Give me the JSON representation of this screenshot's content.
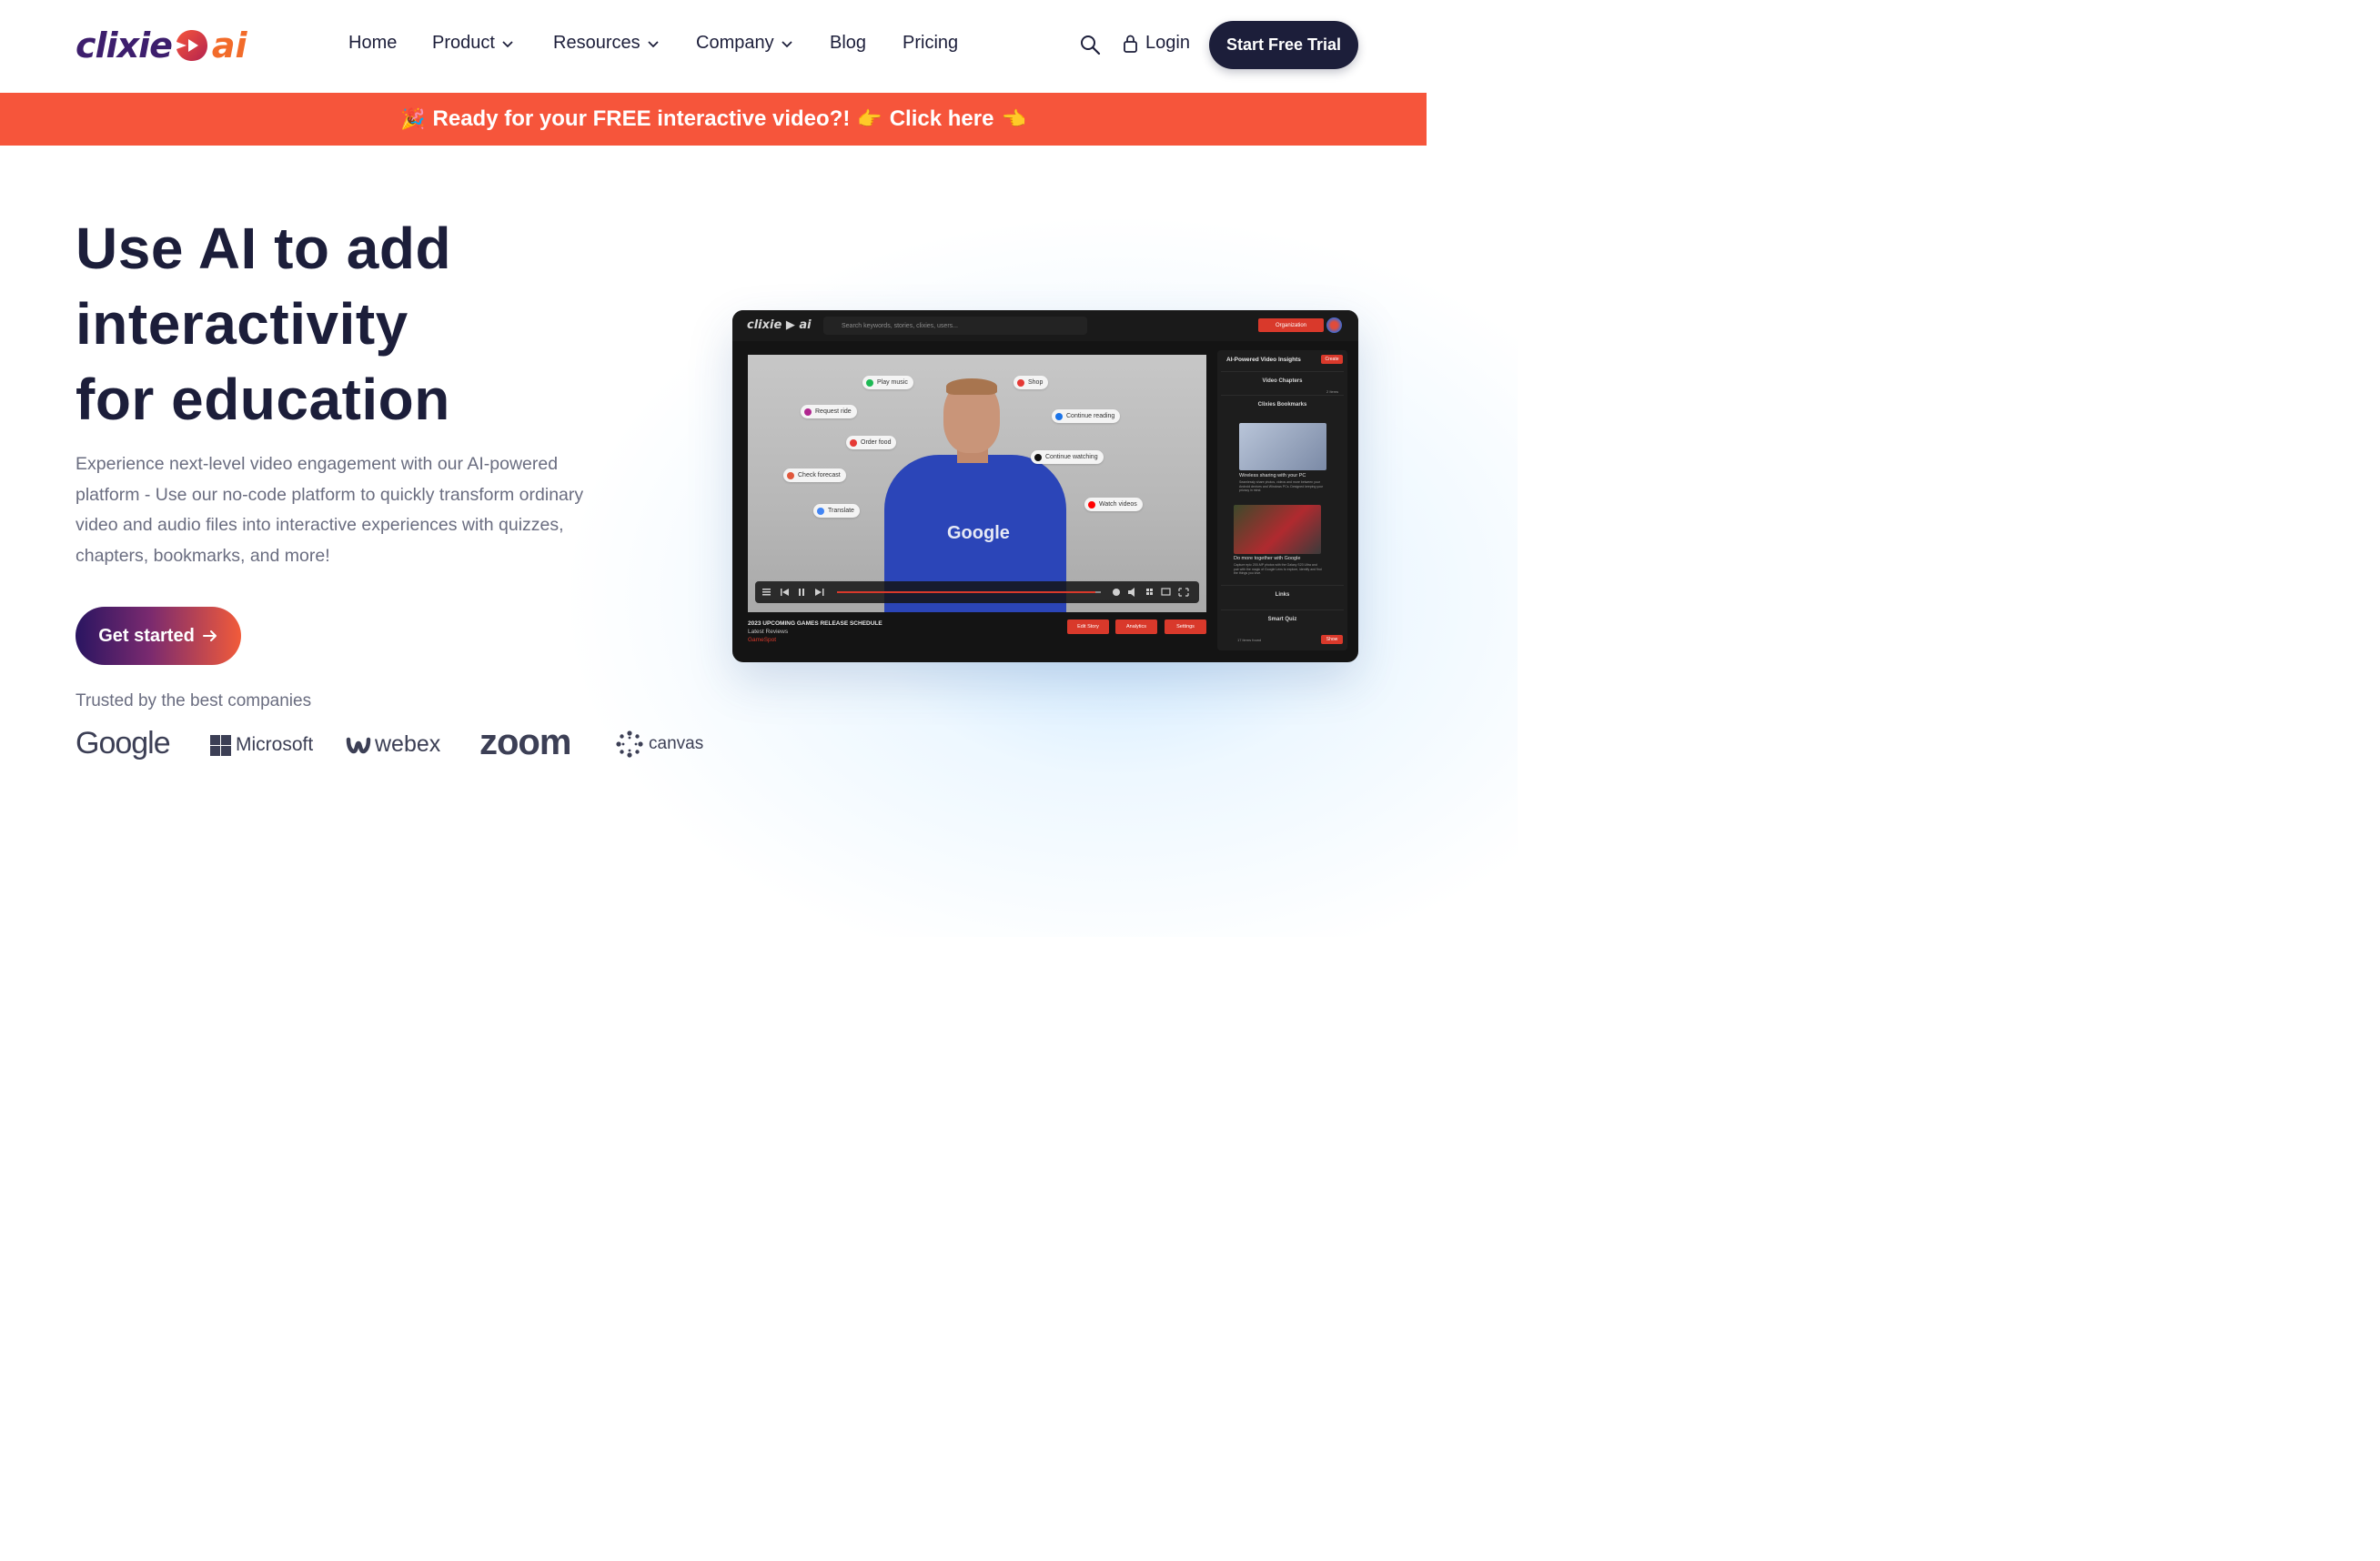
{
  "brand": {
    "name_part1": "clixie",
    "name_part2": "ai",
    "accent": "#f6553b",
    "dark": "#1c1e3a"
  },
  "nav": {
    "items": [
      {
        "label": "Home",
        "has_dropdown": false
      },
      {
        "label": "Product",
        "has_dropdown": true
      },
      {
        "label": "Resources",
        "has_dropdown": true
      },
      {
        "label": "Company",
        "has_dropdown": true
      },
      {
        "label": "Blog",
        "has_dropdown": false
      },
      {
        "label": "Pricing",
        "has_dropdown": false
      }
    ],
    "search_icon": "search-icon",
    "login_label": "Login",
    "trial_label": "Start Free Trial"
  },
  "banner": {
    "emoji_left": "🎉",
    "text": "Ready for your FREE interactive video?!",
    "emoji_mid": "👉",
    "link": "Click here",
    "emoji_right": "👈"
  },
  "hero": {
    "title_lines": [
      "Use AI to add",
      "interactivity",
      "for education"
    ],
    "description": "Experience next-level video engagement with our AI-powered platform - Use our no-code platform to quickly transform ordinary video and audio files into interactive experiences with quizzes, chapters, bookmarks, and more!",
    "cta_label": "Get started",
    "trusted_label": "Trusted by the best companies",
    "companies": [
      "Google",
      "Microsoft",
      "webex",
      "zoom",
      "canvas"
    ]
  },
  "app_preview": {
    "logo": "clixie",
    "logo_ai": "ai",
    "search_placeholder": "Search keywords, stories, clixies, users...",
    "org_button": "Organization",
    "video_chips": [
      {
        "label": "Play music",
        "color": "#1db954"
      },
      {
        "label": "Shop",
        "color": "#e53935"
      },
      {
        "label": "Request ride",
        "color": "#b0268f"
      },
      {
        "label": "Continue reading",
        "color": "#1a73e8"
      },
      {
        "label": "Order food",
        "color": "#e53935"
      },
      {
        "label": "Continue watching",
        "color": "#111111"
      },
      {
        "label": "Check forecast",
        "color": "#e0573b"
      },
      {
        "label": "Watch videos",
        "color": "#ff0000"
      },
      {
        "label": "Translate",
        "color": "#4285f4"
      }
    ],
    "shirt_text": "Google",
    "progress": 0.98,
    "video_title": "2023 UPCOMING GAMES RELEASE SCHEDULE",
    "video_subtitle": "Latest Reviews",
    "video_source": "GameSpot",
    "actions": [
      "Edit Story",
      "Analytics",
      "Settings"
    ],
    "sidebar": {
      "title": "AI-Powered Video Insights",
      "create": "Create",
      "rows": [
        "Video Chapters",
        "Clixies Bookmarks",
        "Links",
        "Smart Quiz"
      ],
      "bookmark_count": "2 Items",
      "bookmark1_title": "Wireless sharing with your PC",
      "bookmark1_desc": "Seamlessly share photos, videos and more between your Android devices and Windows PCs. Designed keeping your privacy in mind.",
      "bookmark2_title": "Do more together with Google",
      "bookmark2_desc": "Capture epic 200-MP photos with the Galaxy S23 Ultra and pair with the magic of Google Lens to explore, identify and find the things you love.",
      "footer_count": "17 items found",
      "show": "Show"
    }
  }
}
